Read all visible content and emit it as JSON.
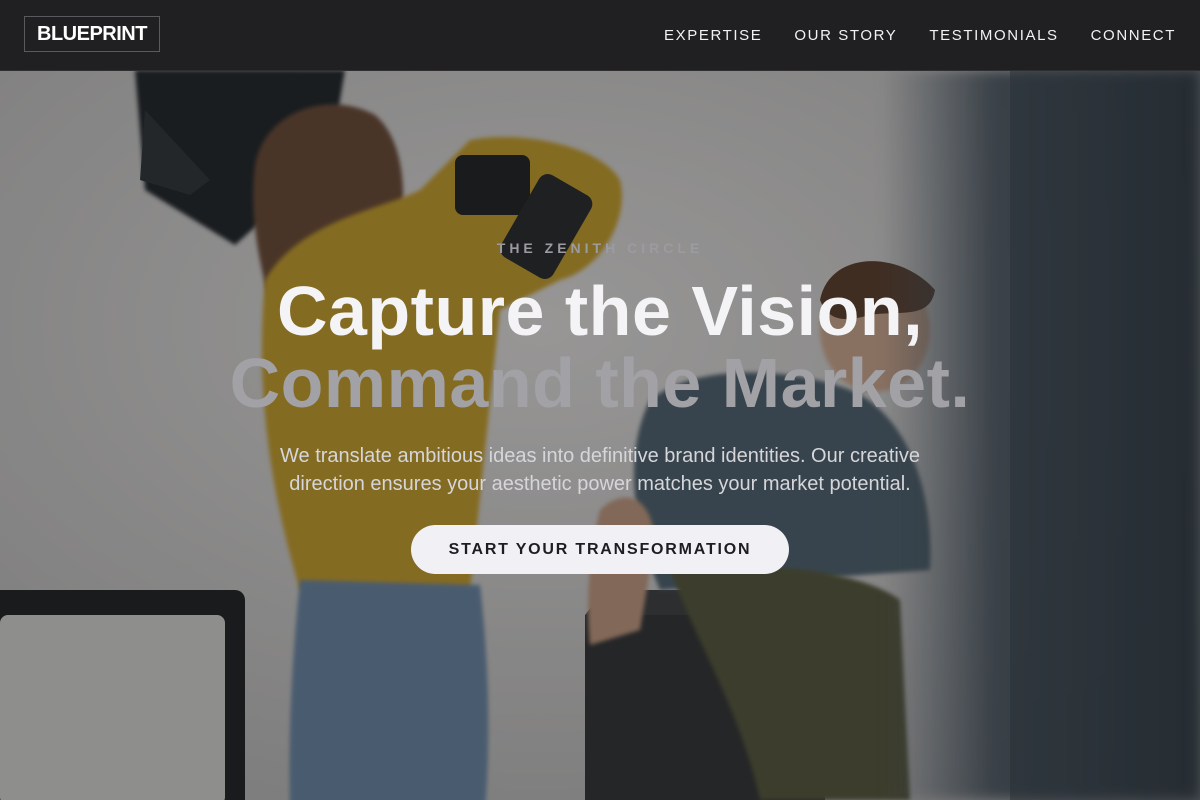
{
  "brand": {
    "logo_text": "BLUEPRINT"
  },
  "nav": {
    "items": [
      {
        "label": "EXPERTISE"
      },
      {
        "label": "OUR STORY"
      },
      {
        "label": "TESTIMONIALS"
      },
      {
        "label": "CONNECT"
      }
    ]
  },
  "hero": {
    "eyebrow": "THE ZENITH CIRCLE",
    "headline_line1": "Capture the Vision,",
    "headline_line2": "Command the Market.",
    "subtitle": "We translate ambitious ideas into definitive brand identities. Our creative direction ensures your aesthetic power matches your market potential.",
    "cta_label": "START YOUR TRANSFORMATION",
    "background_image": "photo-studio-photographer-and-model"
  },
  "colors": {
    "navbar_bg": "#202022",
    "text_primary": "#f4f4f6",
    "text_muted": "#a2a2a6",
    "cta_bg": "#f1f0f5",
    "cta_text": "#1e1e22"
  }
}
